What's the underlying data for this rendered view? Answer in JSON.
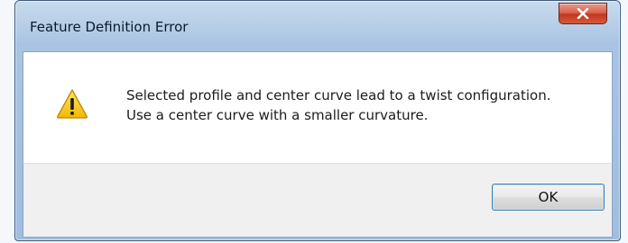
{
  "window": {
    "title": "Feature Definition Error"
  },
  "message": {
    "icon": "warning-icon",
    "line1": "Selected profile and center curve lead to a twist configuration.",
    "line2": "Use a center curve with a smaller curvature."
  },
  "buttons": {
    "ok_label": "OK",
    "close_icon": "close-icon"
  },
  "colors": {
    "close_button": "#c2371f",
    "warning_fill": "#f5c400",
    "frame": "#9fbddf"
  }
}
